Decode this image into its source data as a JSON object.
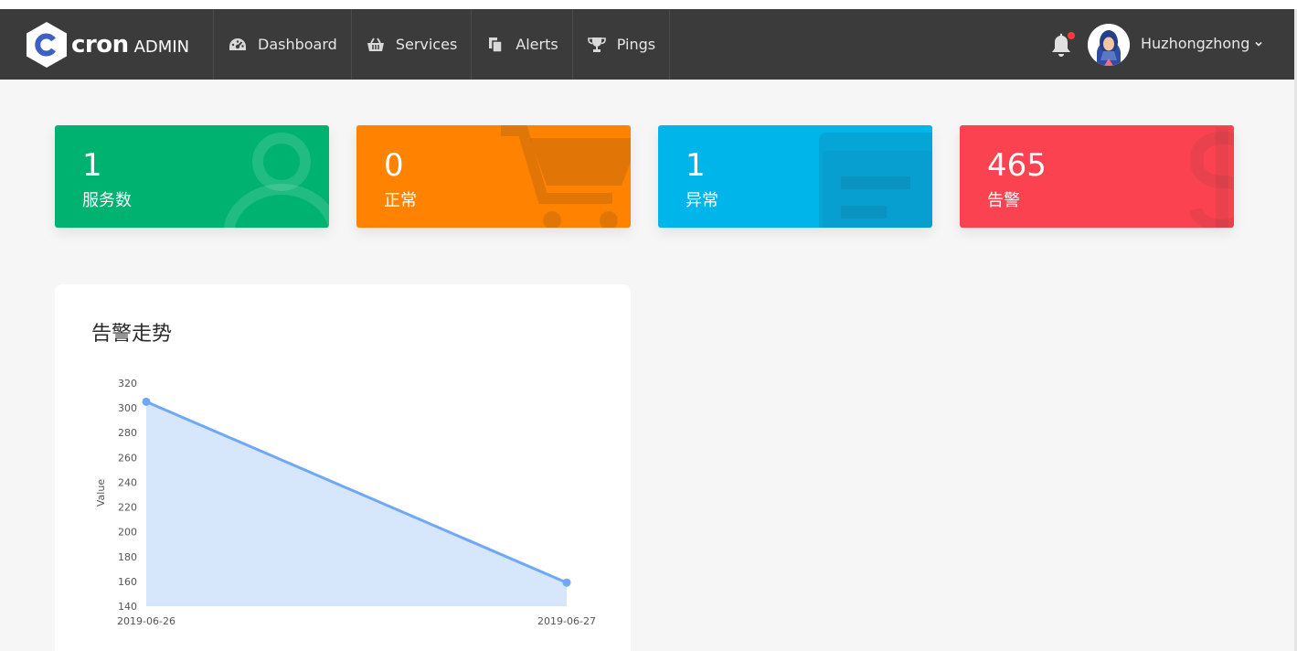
{
  "brand": {
    "name": "cron",
    "suffix": "ADMIN"
  },
  "nav": [
    {
      "label": "Dashboard",
      "icon": "dashboard-icon"
    },
    {
      "label": "Services",
      "icon": "basket-icon"
    },
    {
      "label": "Alerts",
      "icon": "copy-icon"
    },
    {
      "label": "Pings",
      "icon": "trophy-icon"
    }
  ],
  "user": {
    "name": "Huzhongzhong"
  },
  "cards": [
    {
      "value": "1",
      "label": "服务数",
      "color": "#00b26f",
      "icon": "user-icon"
    },
    {
      "value": "0",
      "label": "正常",
      "color": "#ff8300",
      "icon": "cart-icon"
    },
    {
      "value": "1",
      "label": "异常",
      "color": "#00b5e9",
      "icon": "calendar-icon"
    },
    {
      "value": "465",
      "label": "告警",
      "color": "#fa4251",
      "icon": "dollar-icon"
    }
  ],
  "panel": {
    "title": "告警走势"
  },
  "chart_data": {
    "type": "area",
    "x": [
      "2019-06-26",
      "2019-06-27"
    ],
    "series": [
      {
        "values": [
          305,
          159
        ]
      }
    ],
    "ylabel": "Value",
    "xlabel": "",
    "ylim": [
      140,
      320
    ],
    "yticks": [
      140,
      160,
      180,
      200,
      220,
      240,
      260,
      280,
      300,
      320
    ],
    "line_color": "#70a8f8",
    "fill_color": "#d6e6fb",
    "grid": false
  }
}
